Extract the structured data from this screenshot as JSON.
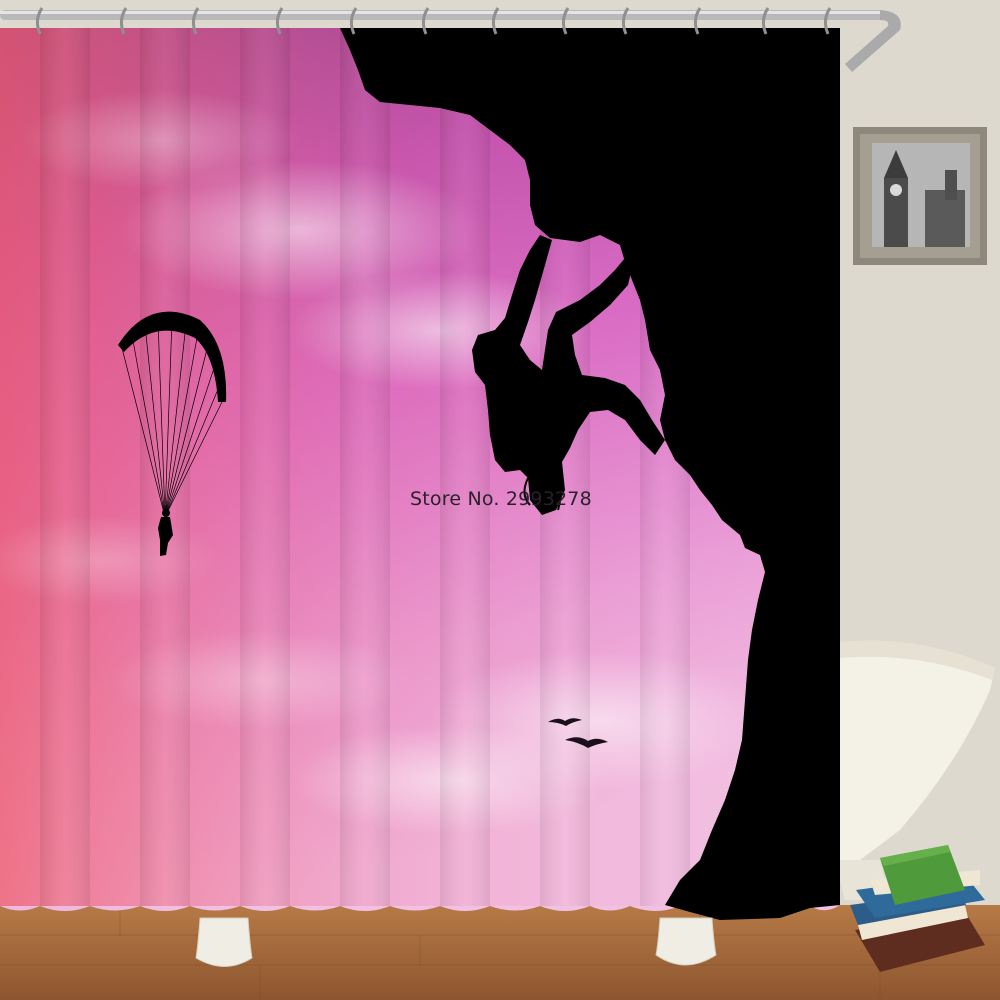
{
  "watermark": {
    "text": "Store No. 2993278"
  },
  "scene": {
    "subject": "shower curtain with pink sunset sky, rock climber silhouette, paraglider and birds",
    "colors": {
      "sky_top": "#8a2f86",
      "sky_mid": "#d764c6",
      "sky_bottom": "#f3a2d6",
      "sky_warm": "#e9607a",
      "silhouette": "#000000",
      "wall": "#ddd9cf",
      "floor": "#a66b3a",
      "rod": "#b9b9b9",
      "tub": "#f4f1e6"
    },
    "icons": [
      "paraglider-icon",
      "climber-icon",
      "bird-icon",
      "picture-frame-icon",
      "books-icon",
      "bathtub-icon"
    ]
  }
}
